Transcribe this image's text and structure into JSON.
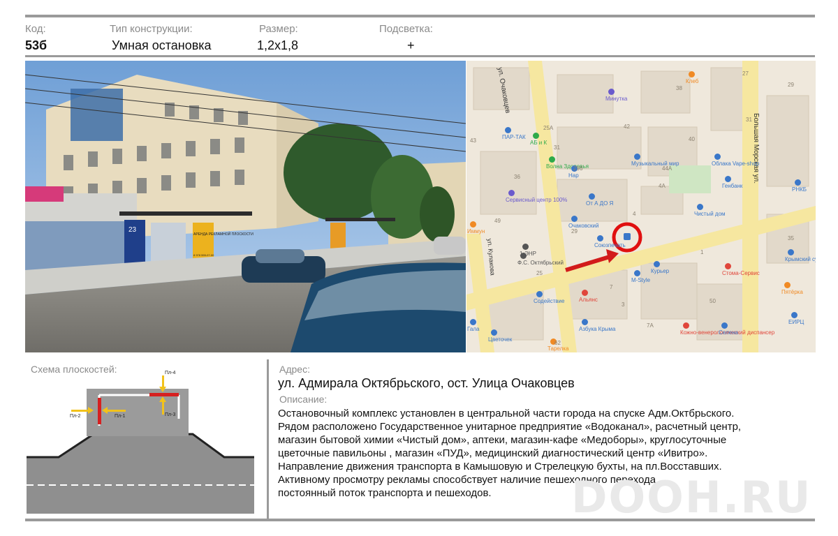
{
  "header": {
    "code_label": "Код:",
    "code_value": "53б",
    "type_label": "Тип конструкции:",
    "type_value": "Умная остановка",
    "size_label": "Размер:",
    "size_value": "1,2х1,8",
    "light_label": "Подсветка:",
    "light_value": "+"
  },
  "photo": {
    "shelter_number": "23",
    "shelter_poster": "АРЕНДА РЕКЛАМНОЙ ПЛОСКОСТИ",
    "shelter_phone": "8 978 555-07-00"
  },
  "map": {
    "streets": [
      "ул. Очаковцев",
      "Большая Морская ул.",
      "ул. Кулакова"
    ],
    "places": [
      {
        "name": "Клеб",
        "color": "#f08a24"
      },
      {
        "name": "Минутка",
        "color": "#6a5acd"
      },
      {
        "name": "ПАР-ТАК",
        "color": "#3a77c9"
      },
      {
        "name": "АБ и К",
        "color": "#2eaa4a"
      },
      {
        "name": "Волна Здоровья",
        "color": "#2eaa4a"
      },
      {
        "name": "Нар",
        "color": "#3a77c9"
      },
      {
        "name": "Музыкальный мир",
        "color": "#3a77c9"
      },
      {
        "name": "Облака Vape-shop",
        "color": "#3a77c9"
      },
      {
        "name": "Генбанк",
        "color": "#3a77c9"
      },
      {
        "name": "РНКБ",
        "color": "#3a77c9"
      },
      {
        "name": "Сервисный центр 100%",
        "color": "#6a5acd"
      },
      {
        "name": "От А ДО Я",
        "color": "#3a77c9"
      },
      {
        "name": "Чистый дом",
        "color": "#3a77c9"
      },
      {
        "name": "Очаковский",
        "color": "#3a77c9"
      },
      {
        "name": "Иммун",
        "color": "#f08a24"
      },
      {
        "name": "Союзпечать",
        "color": "#3a77c9"
      },
      {
        "name": "1-ЭНР",
        "color": "#555555"
      },
      {
        "name": "Ф.С. Октябрьский",
        "color": "#555555"
      },
      {
        "name": "Курьер",
        "color": "#3a77c9"
      },
      {
        "name": "M-Style",
        "color": "#3a77c9"
      },
      {
        "name": "Стома-Сервис",
        "color": "#e0463b"
      },
      {
        "name": "Крымский султан",
        "color": "#3a77c9"
      },
      {
        "name": "Пятёрка",
        "color": "#f08a24"
      },
      {
        "name": "Содействие",
        "color": "#3a77c9"
      },
      {
        "name": "Альянс",
        "color": "#e0463b"
      },
      {
        "name": "Гала",
        "color": "#3a77c9"
      },
      {
        "name": "Цветочек",
        "color": "#3a77c9"
      },
      {
        "name": "Азбука Крыма",
        "color": "#3a77c9"
      },
      {
        "name": "Тарелка",
        "color": "#f08a24"
      },
      {
        "name": "Кожно-венерологический диспансер",
        "color": "#e0463b"
      },
      {
        "name": "Селена",
        "color": "#3a77c9"
      },
      {
        "name": "ЕИРЦ",
        "color": "#3a77c9"
      }
    ],
    "house_numbers": [
      "27",
      "29",
      "38",
      "42",
      "25А",
      "31",
      "40",
      "29б",
      "44А",
      "36",
      "4А",
      "4",
      "29",
      "1",
      "50",
      "7",
      "7А",
      "43",
      "49",
      "25",
      "35",
      "31",
      "62",
      "3"
    ]
  },
  "scheme": {
    "title": "Схема плоскостей:",
    "planes": [
      "Пл-1",
      "Пл-2",
      "Пл-3",
      "Пл-4"
    ]
  },
  "address": {
    "label": "Адрес:",
    "value": "ул. Адмирала Октябрьского, ост. Улица Очаковцев"
  },
  "description": {
    "label": "Описание:",
    "lines": [
      "Остановочный комплекс установлен в центральной части города  на спуске Адм.Октбрьского.",
      "Рядом расположено Государственное унитарное предприятие «Водоканал», расчетный центр,",
      "магазин бытовой химии «Чистый дом», аптеки, магазин-кафе «Медоборы»,  круглосуточные",
      "цветочные павильоны , магазин «ПУД»,  медицинский диагностический центр «Ивитро».",
      "Направление движения транспорта в Камышовую и Стрелецкую бухты, на пл.Восставших.",
      "Активному просмотру рекламы способствует наличие пешеходного перехода,",
      "постоянный  поток транспорта и пешеходов."
    ]
  },
  "watermark": "DOOH.RU",
  "colors": {
    "rule": "#9a9a9a",
    "label_gray": "#8a8a8a",
    "plane_red": "#d62020",
    "arrow_yellow": "#f2c21b",
    "map_marker_red": "#e01010"
  }
}
